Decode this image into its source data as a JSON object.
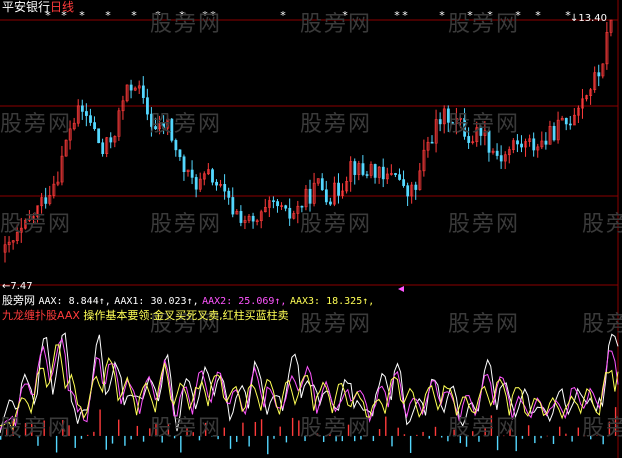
{
  "header": {
    "security": "平安银行",
    "period": "日线"
  },
  "watermark": "股旁网",
  "price_labels": {
    "high": "13.40",
    "low": "7.47"
  },
  "indicator": {
    "site": "股旁网",
    "aax": {
      "name": "AAX:",
      "value": "8.844",
      "arrow": "↑"
    },
    "aax1": {
      "name": "AAX1:",
      "value": "30.023",
      "arrow": "↑"
    },
    "aax2": {
      "name": "AAX2:",
      "value": "25.069",
      "arrow": "↑"
    },
    "aax3": {
      "name": "AAX3:",
      "value": "18.325",
      "arrow": "↑"
    },
    "formula_name": "九龙缠扑股AAX",
    "hint": "操作基本要领:金叉买死叉卖,红柱买蓝柱卖"
  },
  "colors": {
    "background": "#000000",
    "up": "#ff3b3b",
    "down": "#54d8ff",
    "grid": "#8b0000",
    "aax1": "#ffffff",
    "aax2": "#ff55ff",
    "aax3": "#ffff55"
  },
  "chart_data": [
    {
      "type": "candlestick",
      "title": "",
      "ylim": [
        7.47,
        13.4
      ],
      "close_path": [
        8.0,
        8.3,
        8.6,
        9.0,
        9.4,
        9.9,
        10.9,
        11.3,
        11.0,
        10.3,
        10.7,
        11.6,
        12.0,
        11.3,
        10.8,
        11.0,
        10.2,
        9.7,
        9.6,
        9.8,
        9.4,
        9.0,
        8.8,
        8.6,
        8.9,
        9.1,
        8.8,
        9.0,
        9.3,
        9.6,
        9.3,
        9.5,
        10.1,
        9.8,
        10.0,
        9.6,
        10.0,
        9.3,
        9.5,
        10.5,
        11.0,
        11.2,
        11.0,
        10.6,
        10.9,
        10.4,
        10.2,
        10.5,
        10.5,
        10.5,
        10.6,
        10.9,
        11.0,
        11.5,
        11.8,
        12.2,
        13.4
      ]
    },
    {
      "type": "line",
      "title": "",
      "series": [
        {
          "name": "AAX1",
          "values": [
            0.3,
            0.4,
            0.6,
            0.5,
            0.9,
            0.7,
            1.0,
            0.2,
            0.5,
            0.9,
            0.6,
            0.7,
            0.4,
            0.6,
            0.5,
            0.8,
            0.3,
            0.6,
            0.5,
            0.7,
            0.6,
            0.4,
            0.5,
            0.7,
            0.5,
            0.4,
            0.6,
            0.8,
            0.5,
            0.6,
            0.4,
            0.5,
            0.6,
            0.3,
            0.5,
            0.6,
            0.7,
            0.3,
            0.4,
            0.6,
            0.5,
            0.5,
            0.3,
            0.4,
            0.7,
            0.6,
            0.5,
            0.4,
            0.5,
            0.3,
            0.4,
            0.5,
            0.4,
            0.6,
            0.3,
            0.8,
            1.0
          ]
        },
        {
          "name": "AAX2",
          "values": [
            0.2,
            0.3,
            0.5,
            0.6,
            0.8,
            0.8,
            0.9,
            0.3,
            0.4,
            0.8,
            0.7,
            0.6,
            0.5,
            0.5,
            0.6,
            0.7,
            0.4,
            0.5,
            0.6,
            0.6,
            0.6,
            0.5,
            0.4,
            0.6,
            0.6,
            0.4,
            0.5,
            0.7,
            0.6,
            0.5,
            0.5,
            0.4,
            0.6,
            0.4,
            0.4,
            0.6,
            0.6,
            0.4,
            0.4,
            0.5,
            0.6,
            0.4,
            0.4,
            0.4,
            0.6,
            0.6,
            0.5,
            0.4,
            0.4,
            0.4,
            0.4,
            0.4,
            0.5,
            0.5,
            0.4,
            0.7,
            0.9
          ]
        },
        {
          "name": "AAX3",
          "values": [
            0.2,
            0.3,
            0.4,
            0.5,
            0.7,
            0.8,
            0.8,
            0.4,
            0.4,
            0.7,
            0.7,
            0.6,
            0.5,
            0.5,
            0.5,
            0.7,
            0.5,
            0.5,
            0.5,
            0.6,
            0.6,
            0.5,
            0.5,
            0.5,
            0.6,
            0.5,
            0.5,
            0.6,
            0.6,
            0.5,
            0.5,
            0.5,
            0.5,
            0.4,
            0.4,
            0.5,
            0.6,
            0.5,
            0.4,
            0.5,
            0.5,
            0.5,
            0.4,
            0.4,
            0.5,
            0.6,
            0.5,
            0.5,
            0.4,
            0.4,
            0.4,
            0.4,
            0.4,
            0.5,
            0.4,
            0.6,
            0.8
          ]
        }
      ]
    }
  ]
}
